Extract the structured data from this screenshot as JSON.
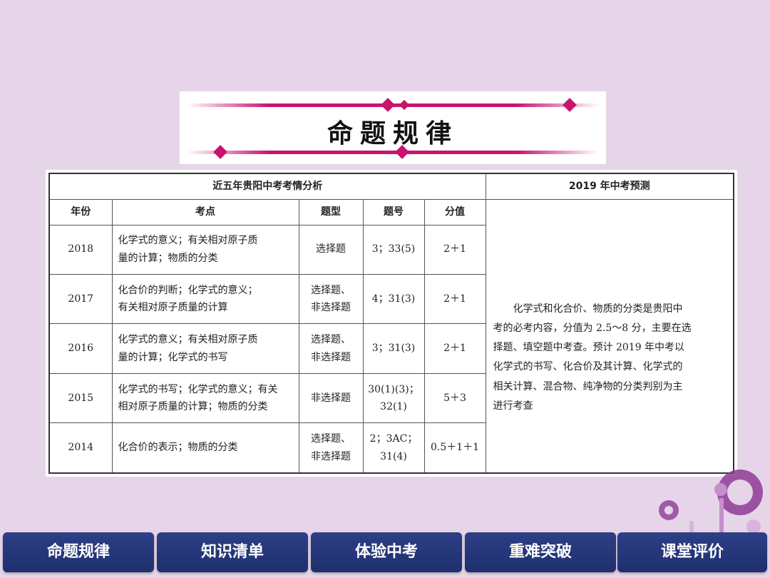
{
  "banner": {
    "title": "命题规律"
  },
  "table": {
    "header_left": "近五年贵阳中考考情分析",
    "header_right": "2019 年中考预测",
    "columns": [
      "年份",
      "考点",
      "题型",
      "题号",
      "分值"
    ],
    "rows": [
      {
        "year": "2018",
        "topic_1": "化学式的意义；有关相对原子质",
        "topic_2": "量的计算；物质的分类",
        "type_1": "选择题",
        "type_2": "",
        "num_1": "3；33(5)",
        "num_2": "",
        "score": "2＋1"
      },
      {
        "year": "2017",
        "topic_1": "化合价的判断；化学式的意义；",
        "topic_2": "有关相对原子质量的计算",
        "type_1": "选择题、",
        "type_2": "非选择题",
        "num_1": "4；31(3)",
        "num_2": "",
        "score": "2＋1"
      },
      {
        "year": "2016",
        "topic_1": "化学式的意义；有关相对原子质",
        "topic_2": "量的计算；化学式的书写",
        "type_1": "选择题、",
        "type_2": "非选择题",
        "num_1": "3；31(3)",
        "num_2": "",
        "score": "2＋1"
      },
      {
        "year": "2015",
        "topic_1": "化学式的书写；化学式的意义；有关",
        "topic_2": "相对原子质量的计算；物质的分类",
        "type_1": "非选择题",
        "type_2": "",
        "num_1": "30(1)(3)；",
        "num_2": "32(1)",
        "score": "5＋3"
      },
      {
        "year": "2014",
        "topic_1": "化合价的表示；物质的分类",
        "topic_2": "",
        "type_1": "选择题、",
        "type_2": "非选择题",
        "num_1": "2；3AC；",
        "num_2": "31(4)",
        "score": "0.5＋1＋1"
      }
    ],
    "forecast_lines": [
      "化学式和化合价、物质的分类是贵阳中",
      "考的必考内容，分值为 2.5～8 分，主要在选",
      "择题、填空题中考查。预计 2019 年中考以",
      "化学式的书写、化合价及其计算、化学式的",
      "相关计算、混合物、纯净物的分类判别为主",
      "进行考查"
    ]
  },
  "nav_tabs": [
    "命题规律",
    "知识清单",
    "体验中考",
    "重难突破",
    "课堂评价"
  ],
  "colors": {
    "accent": "#c8146e",
    "tab_bg": "#2d3f86",
    "background": "#e6d5e8",
    "deco_purple": "#8e3b97"
  }
}
